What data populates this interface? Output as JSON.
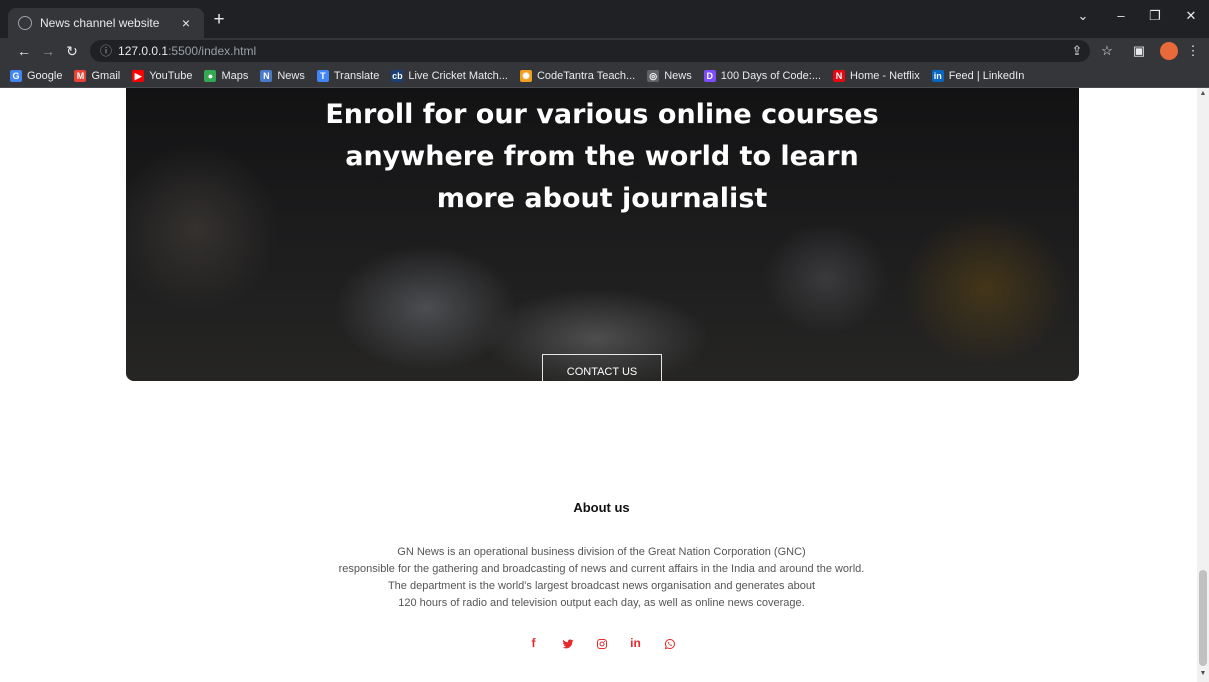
{
  "browser": {
    "tab_title": "News channel website",
    "tab_close": "×",
    "new_tab": "+",
    "controls": [
      "⌄",
      "–",
      "❐",
      "✕"
    ],
    "url_host": "127.0.0.1",
    "url_path": ":5500/index.html",
    "bookmarks": [
      {
        "label": "Google",
        "color": "#4285f4",
        "glyph": "G"
      },
      {
        "label": "Gmail",
        "color": "#ea4335",
        "glyph": "M"
      },
      {
        "label": "YouTube",
        "color": "#ff0000",
        "glyph": "▶"
      },
      {
        "label": "Maps",
        "color": "#34a853",
        "glyph": "●"
      },
      {
        "label": "News",
        "color": "#4a79c9",
        "glyph": "N"
      },
      {
        "label": "Translate",
        "color": "#4285f4",
        "glyph": "T"
      },
      {
        "label": "Live Cricket Match...",
        "color": "#1a3f7a",
        "glyph": "cb"
      },
      {
        "label": "CodeTantra Teach...",
        "color": "#f0a020",
        "glyph": "✺"
      },
      {
        "label": "News",
        "color": "#5f6368",
        "glyph": "◎"
      },
      {
        "label": "100 Days of Code:...",
        "color": "#7c4dff",
        "glyph": "D"
      },
      {
        "label": "Home - Netflix",
        "color": "#e50914",
        "glyph": "N"
      },
      {
        "label": "Feed | LinkedIn",
        "color": "#0a66c2",
        "glyph": "in"
      }
    ]
  },
  "hero": {
    "title": "Enroll for our various online courses anywhere from the world to learn more about journalist",
    "button_label": "CONTACT US"
  },
  "about": {
    "title": "About us",
    "lines": [
      "GN News is an operational business division of the Great Nation Corporation (GNC)",
      "responsible for the gathering and broadcasting of news and current affairs in the India and around the world.",
      "The department is the world's largest broadcast news organisation and generates about",
      "120 hours of radio and television output each day, as well as online news coverage."
    ]
  },
  "social": {
    "accent_color": "#e52b2b",
    "icons": [
      "facebook-icon",
      "twitter-icon",
      "instagram-icon",
      "linkedin-icon",
      "whatsapp-icon"
    ],
    "facebook": "f",
    "linkedin": "in"
  }
}
